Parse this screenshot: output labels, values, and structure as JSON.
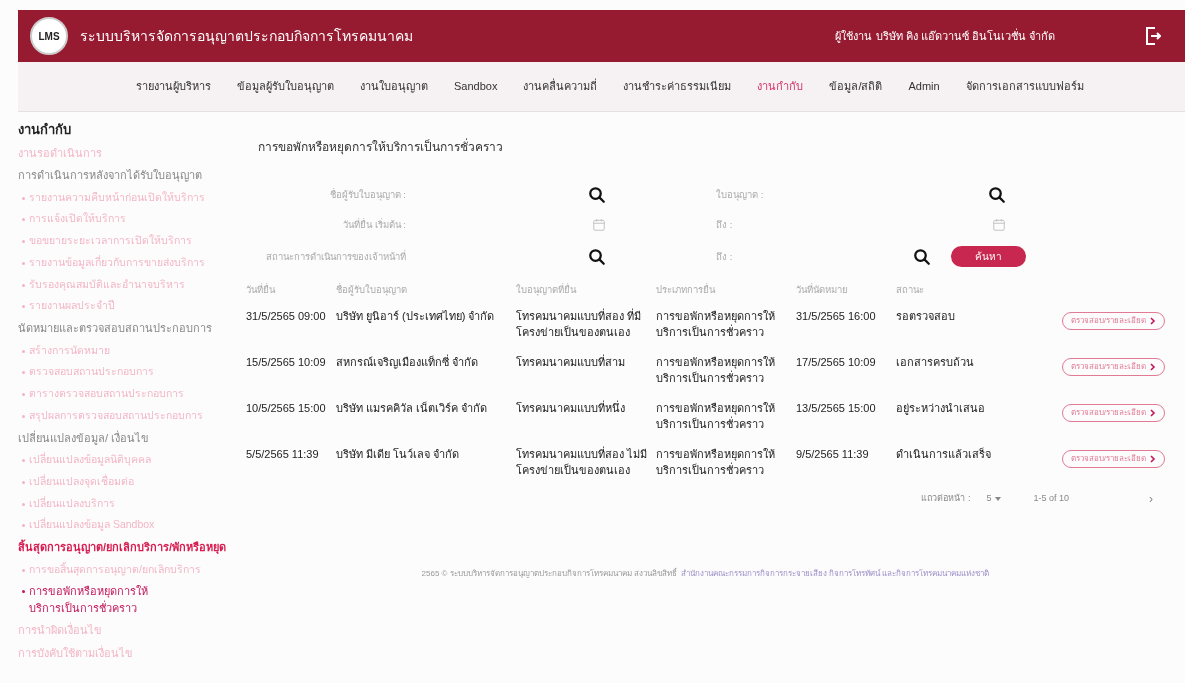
{
  "header": {
    "logo": "LMS",
    "title": "ระบบบริหารจัดการอนุญาตประกอบกิจการโทรคมนาคม",
    "user_label": "ผู้ใช้งาน",
    "user_name": "บริษัท คิง แอ๊ดวานซ์ อินโนเวชั่น จำกัด"
  },
  "nav": [
    {
      "label": "รายงานผู้บริหาร",
      "selected": false
    },
    {
      "label": "ข้อมูลผู้รับใบอนุญาต",
      "selected": false
    },
    {
      "label": "งานใบอนุญาต",
      "selected": false
    },
    {
      "label": "Sandbox",
      "selected": false
    },
    {
      "label": "งานคลื่นความถี่",
      "selected": false
    },
    {
      "label": "งานชำระค่าธรรมเนียม",
      "selected": false
    },
    {
      "label": "งานกำกับ",
      "selected": true
    },
    {
      "label": "ข้อมูล/สถิติ",
      "selected": false
    },
    {
      "label": "Admin",
      "selected": false
    },
    {
      "label": "จัดการเอกสารแบบฟอร์ม",
      "selected": false
    }
  ],
  "sidebar": {
    "title": "งานกำกับ",
    "items": [
      {
        "kind": "link",
        "label": "งานรอดำเนินการ",
        "selected": false
      },
      {
        "kind": "section",
        "label": "การดำเนินการหลังจากได้รับใบอนุญาต",
        "selected": false,
        "children": [
          {
            "kind": "item",
            "label": "รายงานความคืบหน้าก่อนเปิดให้บริการ",
            "selected": false
          },
          {
            "kind": "item",
            "label": "การแจ้งเปิดให้บริการ",
            "selected": false
          },
          {
            "kind": "item",
            "label": "ขอขยายระยะเวลาการเปิดให้บริการ",
            "selected": false
          },
          {
            "kind": "item",
            "label": "รายงานข้อมูลเกี่ยวกับการขายส่งบริการ",
            "selected": false
          },
          {
            "kind": "item",
            "label": "รับรองคุณสมบัติและอำนาจบริหาร",
            "selected": false
          },
          {
            "kind": "item",
            "label": "รายงานผลประจำปี",
            "selected": false
          }
        ]
      },
      {
        "kind": "section",
        "label": "นัดหมายและตรวจสอบสถานประกอบการ",
        "selected": false,
        "children": [
          {
            "kind": "item",
            "label": "สร้างการนัดหมาย",
            "selected": false
          },
          {
            "kind": "item",
            "label": "ตรวจสอบสถานประกอบการ",
            "selected": false
          },
          {
            "kind": "item",
            "label": "ตารางตรวจสอบสถานประกอบการ",
            "selected": false
          },
          {
            "kind": "item",
            "label": "สรุปผลการตรวจสอบสถานประกอบการ",
            "selected": false
          }
        ]
      },
      {
        "kind": "section",
        "label": "เปลี่ยนแปลงข้อมูล/ เงื่อนไข",
        "selected": false,
        "children": [
          {
            "kind": "item",
            "label": "เปลี่ยนแปลงข้อมูลนิติบุคคล",
            "selected": false
          },
          {
            "kind": "item",
            "label": "เปลี่ยนแปลงจุดเชื่อมต่อ",
            "selected": false
          },
          {
            "kind": "item",
            "label": "เปลี่ยนแปลงบริการ",
            "selected": false
          },
          {
            "kind": "item",
            "label": "เปลี่ยนแปลงข้อมูล Sandbox",
            "selected": false
          }
        ]
      },
      {
        "kind": "section",
        "label": "สิ้นสุดการอนุญาต/ยกเลิกบริการ/พักหรือหยุด",
        "selected": true,
        "children": [
          {
            "kind": "item",
            "label": "การขอสิ้นสุดการอนุญาต/ยกเลิกบริการ",
            "selected": false
          },
          {
            "kind": "item",
            "label": "การขอพักหรือหยุดการให้บริการเป็นการชั่วคราว",
            "selected": true
          }
        ]
      },
      {
        "kind": "link",
        "label": "การนำผิดเงื่อนไข",
        "selected": false
      },
      {
        "kind": "link",
        "label": "การบังคับใช้ตามเงื่อนไข",
        "selected": false
      }
    ]
  },
  "page_title": "การขอพักหรือหยุดการให้บริการเป็นการชั่วคราว",
  "filters": [
    {
      "label": "ชื่อผู้รับใบอนุญาต :",
      "kind": "search"
    },
    {
      "label": "ใบอนุญาต :",
      "kind": "search"
    },
    {
      "label": "วันที่ยื่น เริ่มต้น :",
      "kind": "date"
    },
    {
      "label": "ถึง :",
      "kind": "date"
    },
    {
      "label": "สถานะการดำเนินการของเจ้าหน้าที่",
      "kind": "search"
    },
    {
      "label": "ถึง :",
      "kind": "search"
    }
  ],
  "search_button": "ค้นหา",
  "table": {
    "columns": [
      "วันที่ยื่น",
      "ชื่อผู้รับใบอนุญาต",
      "ใบอนุญาตที่ยื่น",
      "ประเภทการยื่น",
      "วันที่นัดหมาย",
      "สถานะ"
    ],
    "rows": [
      {
        "submitted": "31/5/2565  09:00",
        "licensee": "บริษัท ยูนิอาร์ (ประเทศไทย) จำกัด",
        "license": "โทรคมนาคมแบบที่สอง ที่มีโครงข่ายเป็นของตนเอง",
        "type": "การขอพักหรือหยุดการให้บริการเป็นการชั่วคราว",
        "appointment": "31/5/2565  16:00",
        "status": "รอตรวจสอบ",
        "action": "ตรวจสอบ/รายละเอียด"
      },
      {
        "submitted": "15/5/2565  10:09",
        "licensee": "สหกรณ์เจริญเมืองแท็กซี่ จำกัด",
        "license": "โทรคมนาคมแบบที่สาม",
        "type": "การขอพักหรือหยุดการให้บริการเป็นการชั่วคราว",
        "appointment": "17/5/2565  10:09",
        "status": "เอกสารครบถ้วน",
        "action": "ตรวจสอบ/รายละเอียด"
      },
      {
        "submitted": "10/5/2565  15:00",
        "licensee": "บริษัท แมรคคิวัล เน็ตเวิร์ค จำกัด",
        "license": "โทรคมนาคมแบบที่หนึ่ง",
        "type": "การขอพักหรือหยุดการให้บริการเป็นการชั่วคราว",
        "appointment": "13/5/2565  15:00",
        "status": "อยู่ระหว่างนำเสนอ",
        "action": "ตรวจสอบ/รายละเอียด"
      },
      {
        "submitted": "5/5/2565  11:39",
        "licensee": "บริษัท มีเดีย โนว์เลจ จำกัด",
        "license": "โทรคมนาคมแบบที่สอง ไม่มีโครงข่ายเป็นของตนเอง",
        "type": "การขอพักหรือหยุดการให้บริการเป็นการชั่วคราว",
        "appointment": "9/5/2565  11:39",
        "status": "ดำเนินการแล้วเสร็จ",
        "action": "ตรวจสอบ/รายละเอียด"
      }
    ]
  },
  "pagination": {
    "rows_label": "แถวต่อหน้า :",
    "rows_value": "5",
    "range": "1-5 of 10",
    "next": "›"
  },
  "footer": {
    "text": "2565 © ระบบบริหารจัดการอนุญาตประกอบกิจการโทรคมนาคม สงวนลิขสิทธิ์",
    "link": "สำนักงานคณะกรรมการกิจการกระจายเสียง กิจการโทรทัศน์ และกิจการโทรคมนาคมแห่งชาติ"
  }
}
